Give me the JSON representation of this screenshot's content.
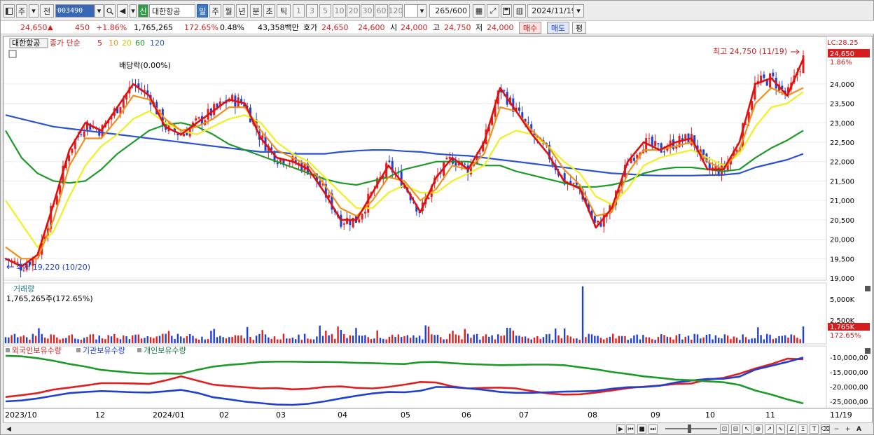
{
  "toolbar": {
    "period_week": "주",
    "prev_label": "전",
    "code": "003490",
    "name": "대한항공",
    "badge": "신",
    "period_buttons": [
      "일",
      "주",
      "월",
      "년",
      "분",
      "초",
      "틱"
    ],
    "active_period": "일",
    "minute_buttons": [
      "1",
      "3",
      "5",
      "10",
      "20",
      "30",
      "60",
      "120"
    ],
    "count": "265",
    "max": "/600",
    "date": "2024/11/19"
  },
  "quote": {
    "price": "24,650",
    "arrow": "▲",
    "change": "450",
    "pct": "+1.86%",
    "volume": "1,765,265",
    "vol_ratio": "172.65%",
    "turnover": "0.48%",
    "amount": "43,358백만",
    "hoga_label": "호가",
    "ask": "24,650",
    "bid": "24,600",
    "open_label": "시",
    "open": "24,000",
    "high_label": "고",
    "high": "24,750",
    "low_label": "저",
    "low": "24,000",
    "sell_btn": "매수",
    "buy_btn": "매도",
    "avg_btn": "평"
  },
  "price_panel": {
    "stock_label": "대한항공",
    "ma_legend_title": "종가 단순",
    "ma_periods": [
      "5",
      "10",
      "20",
      "60",
      "120"
    ],
    "dividend_note": "배당락(0.00%)",
    "high_note": "최고 24,750 (11/19)",
    "low_note": "최저 19,220 (10/20)",
    "lc_label": "LC:28.25",
    "price_tag": "24,650",
    "pct_tag": "1.86%",
    "y_ticks": [
      "24,000",
      "23,500",
      "23,000",
      "22,500",
      "22,000",
      "21,500",
      "21,000",
      "20,500",
      "20,000",
      "19,500",
      "19,000"
    ]
  },
  "volume_panel": {
    "title": "거래량",
    "value": "1,765,265주(172.65%)",
    "y_ticks": [
      "5,000K",
      "2,500K"
    ],
    "tag_value": "1,765K",
    "tag_pct": "172.65%"
  },
  "holdings_panel": {
    "legend": [
      "외국인보유수량",
      "기관보유수량",
      "개인보유수량"
    ],
    "y_ticks": [
      "-10,000,00",
      "-15,000,00",
      "-20,000,00",
      "-25,000,00"
    ]
  },
  "x_axis": {
    "labels": [
      "2023/10",
      "12",
      "2024/01",
      "02",
      "03",
      "04",
      "05",
      "06",
      "07",
      "08",
      "09",
      "10",
      "11",
      "11/19"
    ]
  },
  "colors": {
    "up": "#e02020",
    "down": "#2040d0",
    "ma5": "#e01010",
    "ma10": "#f0901a",
    "ma20": "#f0f020",
    "ma60": "#1e9a2a",
    "ma120": "#2c52d0"
  },
  "chart_data": [
    {
      "type": "candlestick",
      "title": "대한항공",
      "y_range": [
        19000,
        24900
      ],
      "y_unit": "KRW",
      "x_range": [
        "2023-10",
        "2024-11-19"
      ],
      "last_close": 24650,
      "high": {
        "value": 24750,
        "date": "11/19"
      },
      "low": {
        "value": 19220,
        "date": "10/20"
      },
      "ma_series": [
        {
          "name": "5",
          "values": [
            19500,
            19300,
            19600,
            20900,
            22300,
            23000,
            22800,
            23400,
            24000,
            23700,
            22900,
            22700,
            23000,
            23300,
            23600,
            23500,
            22600,
            22100,
            22000,
            21800,
            21200,
            20500,
            20500,
            21200,
            21900,
            21400,
            20700,
            21600,
            22100,
            21800,
            22500,
            23900,
            23300,
            22700,
            22200,
            21500,
            21300,
            20300,
            20800,
            22000,
            22500,
            22300,
            22500,
            22600,
            21800,
            21800,
            22500,
            24000,
            24150,
            23700,
            24650
          ]
        },
        {
          "name": "10",
          "values": [
            19800,
            19500,
            19500,
            20500,
            21900,
            22600,
            22600,
            23100,
            23700,
            23600,
            23100,
            22800,
            22900,
            23100,
            23400,
            23400,
            22800,
            22300,
            22100,
            21900,
            21400,
            20800,
            20600,
            21000,
            21600,
            21500,
            21000,
            21300,
            21900,
            21800,
            22200,
            23400,
            23300,
            22800,
            22400,
            21800,
            21400,
            20600,
            20700,
            21700,
            22300,
            22300,
            22400,
            22500,
            22000,
            21800,
            22300,
            23500,
            23900,
            23700,
            23900
          ]
        },
        {
          "name": "20",
          "values": [
            21000,
            20400,
            19800,
            20200,
            21100,
            21900,
            22400,
            22700,
            23100,
            23300,
            23000,
            22800,
            22700,
            22900,
            23100,
            23200,
            23000,
            22500,
            22200,
            22000,
            21600,
            21200,
            20800,
            20800,
            21200,
            21400,
            21200,
            21200,
            21500,
            21700,
            21900,
            22600,
            22800,
            22700,
            22400,
            22000,
            21700,
            21100,
            20900,
            21300,
            21900,
            22100,
            22200,
            22300,
            22100,
            21900,
            22200,
            22900,
            23400,
            23500,
            23800
          ]
        },
        {
          "name": "60",
          "values": [
            22800,
            22100,
            21700,
            21500,
            21450,
            21500,
            21800,
            22200,
            22500,
            22800,
            22950,
            23000,
            22900,
            22700,
            22450,
            22300,
            22150,
            22000,
            21850,
            21700,
            21550,
            21450,
            21400,
            21500,
            21600,
            21800,
            21900,
            22000,
            22000,
            22000,
            21900,
            21900,
            21750,
            21650,
            21550,
            21450,
            21350,
            21350,
            21400,
            21500,
            21700,
            21800,
            21850,
            21850,
            21800,
            21750,
            21800,
            22100,
            22350,
            22550,
            22800
          ]
        },
        {
          "name": "120",
          "values": [
            23200,
            23100,
            23000,
            22900,
            22850,
            22800,
            22750,
            22700,
            22650,
            22600,
            22550,
            22500,
            22450,
            22400,
            22350,
            22300,
            22250,
            22250,
            22200,
            22200,
            22200,
            22250,
            22280,
            22300,
            22300,
            22270,
            22250,
            22200,
            22170,
            22150,
            22100,
            22050,
            22000,
            21950,
            21900,
            21850,
            21800,
            21750,
            21700,
            21680,
            21650,
            21640,
            21640,
            21640,
            21650,
            21660,
            21700,
            21850,
            21950,
            22050,
            22200
          ]
        }
      ]
    },
    {
      "type": "bar",
      "title": "거래량",
      "value_shown": "1,765,265주(172.65%)",
      "y_ticks": [
        "5,000K",
        "2,500K"
      ],
      "last": 1765265,
      "max_spike_date": "2024-06-27",
      "max_spike": 6000000
    },
    {
      "type": "line",
      "title": "보유수량",
      "series": [
        {
          "name": "외국인보유수량",
          "color": "#e02020",
          "values": [
            -23500,
            -22900,
            -22200,
            -21000,
            -20300,
            -19600,
            -18800,
            -18800,
            -18900,
            -19100,
            -17900,
            -16500,
            -17900,
            -19300,
            -19800,
            -20200,
            -20600,
            -20500,
            -20900,
            -20700,
            -20100,
            -19900,
            -20400,
            -20600,
            -20100,
            -19300,
            -18400,
            -18600,
            -19900,
            -20600,
            -20400,
            -20300,
            -20600,
            -21500,
            -22300,
            -22700,
            -22600,
            -22000,
            -21300,
            -20500,
            -20000,
            -19600,
            -19100,
            -18900,
            -17600,
            -17000,
            -15600,
            -13800,
            -12300,
            -10500,
            -10700
          ]
        },
        {
          "name": "기관보유수량",
          "color": "#2040d0",
          "values": [
            -25000,
            -24700,
            -24000,
            -23100,
            -22200,
            -21800,
            -21500,
            -21700,
            -21900,
            -22000,
            -21600,
            -21100,
            -22100,
            -23600,
            -24300,
            -25100,
            -25600,
            -26100,
            -26200,
            -25800,
            -25000,
            -24000,
            -23100,
            -22300,
            -21800,
            -21900,
            -21400,
            -20100,
            -20200,
            -20600,
            -21100,
            -21800,
            -22100,
            -22100,
            -21900,
            -21700,
            -21600,
            -21400,
            -20700,
            -20200,
            -20100,
            -19700,
            -18600,
            -17900,
            -17400,
            -17300,
            -16600,
            -14200,
            -12900,
            -11600,
            -10100
          ]
        },
        {
          "name": "개인보유수량",
          "color": "#1e9a2a",
          "values": [
            -9500,
            -9700,
            -10300,
            -11200,
            -12300,
            -13200,
            -14300,
            -14800,
            -15300,
            -15600,
            -15500,
            -15600,
            -14300,
            -13200,
            -12600,
            -12200,
            -11600,
            -11500,
            -11500,
            -11600,
            -11600,
            -11700,
            -11900,
            -12000,
            -12200,
            -12300,
            -11700,
            -11600,
            -12000,
            -12300,
            -12500,
            -12700,
            -12600,
            -12500,
            -12500,
            -12700,
            -13400,
            -14100,
            -15000,
            -15700,
            -16500,
            -17000,
            -17600,
            -17800,
            -18200,
            -18500,
            -19400,
            -21300,
            -22700,
            -24300,
            -25700
          ]
        }
      ]
    }
  ]
}
